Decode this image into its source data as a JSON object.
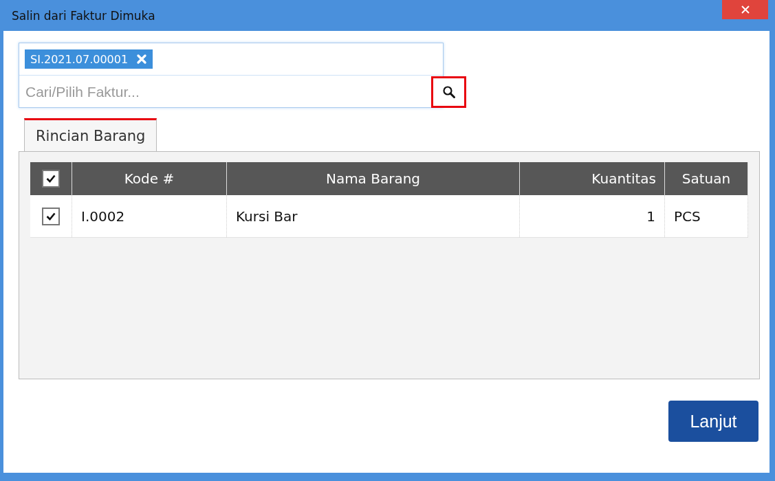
{
  "window": {
    "title": "Salin dari Faktur Dimuka"
  },
  "invoice_picker": {
    "tags": [
      {
        "label": "SI.2021.07.00001"
      }
    ],
    "placeholder": "Cari/Pilih Faktur..."
  },
  "tabs": [
    {
      "label": "Rincian Barang",
      "selected": true
    }
  ],
  "table": {
    "select_all": {
      "checked": true
    },
    "columns": [
      {
        "label": "Kode #"
      },
      {
        "label": "Nama Barang"
      },
      {
        "label": "Kuantitas"
      },
      {
        "label": "Satuan"
      }
    ],
    "rows": [
      {
        "checked": true,
        "cells": [
          "I.0002",
          "Kursi Bar",
          "1",
          "PCS"
        ]
      }
    ]
  },
  "buttons": [
    {
      "label": "Lanjut"
    }
  ]
}
